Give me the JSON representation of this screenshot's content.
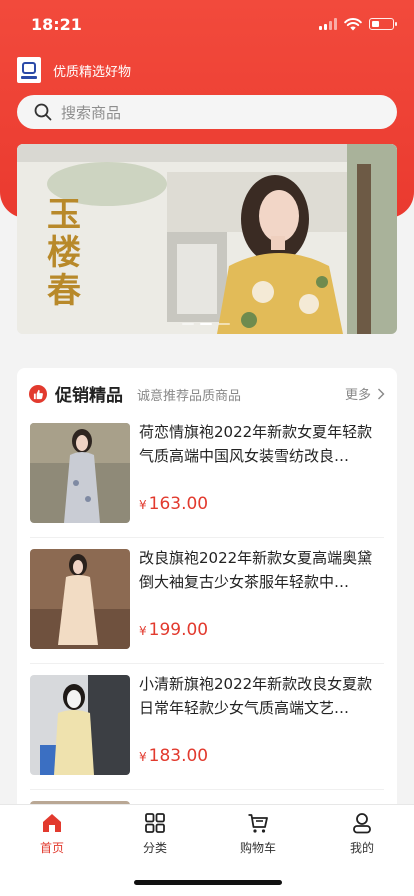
{
  "status_bar": {
    "time": "18:21"
  },
  "header": {
    "tagline": "优质精选好物"
  },
  "search": {
    "placeholder": "搜索商品"
  },
  "banner": {
    "title_text": "玉楼春",
    "slide_count": 3,
    "active_slide": 2
  },
  "promo": {
    "title": "促销精品",
    "subtitle": "诚意推荐品质商品",
    "more_label": "更多"
  },
  "products": [
    {
      "name": "荷恋情旗袍2022年新款女夏年轻款气质高端中国风女装雪纺改良…",
      "currency": "¥",
      "price": "163.00"
    },
    {
      "name": "改良旗袍2022年新款女夏高端奥黛倒大袖复古少女茶服年轻款中…",
      "currency": "¥",
      "price": "199.00"
    },
    {
      "name": "小清新旗袍2022年新款改良女夏款日常年轻款少女气质高端文艺…",
      "currency": "¥",
      "price": "183.00"
    }
  ],
  "tabbar": {
    "items": [
      {
        "label": "首页",
        "icon": "home-icon",
        "active": true
      },
      {
        "label": "分类",
        "icon": "grid-icon",
        "active": false
      },
      {
        "label": "购物车",
        "icon": "cart-icon",
        "active": false
      },
      {
        "label": "我的",
        "icon": "user-icon",
        "active": false
      }
    ]
  },
  "colors": {
    "brand": "#ea3a2f",
    "price": "#e23a2e",
    "background": "#f3f3f3"
  }
}
